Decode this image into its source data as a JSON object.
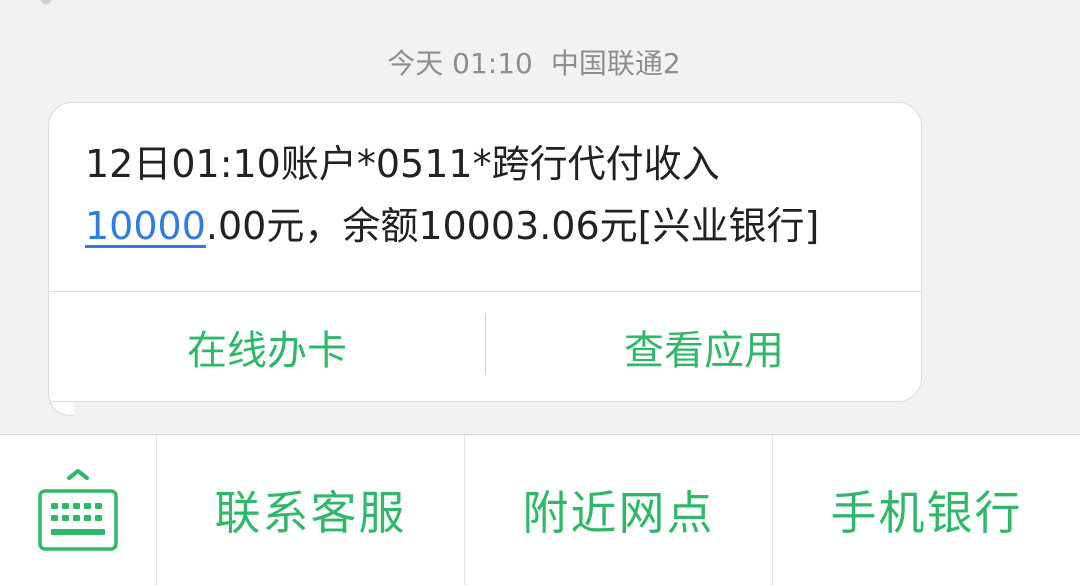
{
  "message_meta": {
    "time": "今天 01:10",
    "carrier": "中国联通2"
  },
  "message": {
    "line1": "12日01:10账户*0511*跨行代付收入",
    "amount_link": "10000",
    "line2_rest": ".00元，余额10003.06元[兴业银行]"
  },
  "bubble_actions": [
    {
      "label": "在线办卡"
    },
    {
      "label": "查看应用"
    }
  ],
  "bottom_menu": {
    "keyboard_icon": "keyboard-icon",
    "items": [
      {
        "label": "联系客服"
      },
      {
        "label": "附近网点"
      },
      {
        "label": "手机银行"
      }
    ]
  },
  "colors": {
    "accent": "#2fb86a",
    "link": "#2f7de1",
    "meta_text": "#8e8e8e",
    "body_text": "#222222"
  }
}
